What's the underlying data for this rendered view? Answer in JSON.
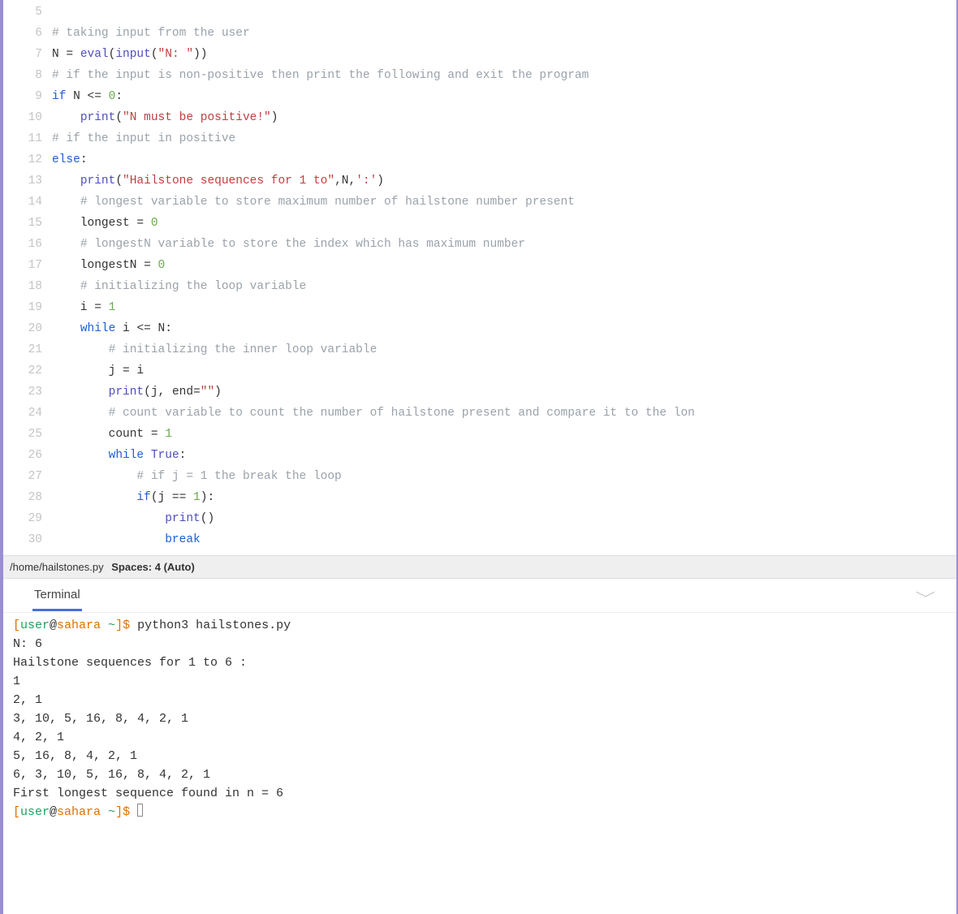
{
  "editor": {
    "lines": [
      {
        "n": "5",
        "segs": []
      },
      {
        "n": "6",
        "segs": [
          {
            "c": "cm",
            "t": "# taking input from the user"
          }
        ]
      },
      {
        "n": "7",
        "segs": [
          {
            "c": "id",
            "t": "N "
          },
          {
            "c": "op",
            "t": "= "
          },
          {
            "c": "bi",
            "t": "eval"
          },
          {
            "c": "op",
            "t": "("
          },
          {
            "c": "bi",
            "t": "input"
          },
          {
            "c": "op",
            "t": "("
          },
          {
            "c": "st",
            "t": "\"N: \""
          },
          {
            "c": "op",
            "t": "))"
          }
        ]
      },
      {
        "n": "8",
        "segs": [
          {
            "c": "cm",
            "t": "# if the input is non-positive then print the following and exit the program"
          }
        ]
      },
      {
        "n": "9",
        "segs": [
          {
            "c": "kw",
            "t": "if"
          },
          {
            "c": "id",
            "t": " N "
          },
          {
            "c": "op",
            "t": "<= "
          },
          {
            "c": "nm",
            "t": "0"
          },
          {
            "c": "op",
            "t": ":"
          }
        ]
      },
      {
        "n": "10",
        "segs": [
          {
            "c": "id",
            "t": "    "
          },
          {
            "c": "bi",
            "t": "print"
          },
          {
            "c": "op",
            "t": "("
          },
          {
            "c": "st",
            "t": "\"N must be positive!\""
          },
          {
            "c": "op",
            "t": ")"
          }
        ]
      },
      {
        "n": "11",
        "segs": [
          {
            "c": "cm",
            "t": "# if the input in positive"
          }
        ]
      },
      {
        "n": "12",
        "segs": [
          {
            "c": "kw",
            "t": "else"
          },
          {
            "c": "op",
            "t": ":"
          }
        ]
      },
      {
        "n": "13",
        "segs": [
          {
            "c": "id",
            "t": "    "
          },
          {
            "c": "bi",
            "t": "print"
          },
          {
            "c": "op",
            "t": "("
          },
          {
            "c": "st",
            "t": "\"Hailstone sequences for 1 to\""
          },
          {
            "c": "op",
            "t": ",N,"
          },
          {
            "c": "st",
            "t": "':'"
          },
          {
            "c": "op",
            "t": ")"
          }
        ]
      },
      {
        "n": "14",
        "segs": [
          {
            "c": "id",
            "t": "    "
          },
          {
            "c": "cm",
            "t": "# longest variable to store maximum number of hailstone number present"
          }
        ]
      },
      {
        "n": "15",
        "segs": [
          {
            "c": "id",
            "t": "    longest "
          },
          {
            "c": "op",
            "t": "= "
          },
          {
            "c": "nm",
            "t": "0"
          }
        ]
      },
      {
        "n": "16",
        "segs": [
          {
            "c": "id",
            "t": "    "
          },
          {
            "c": "cm",
            "t": "# longestN variable to store the index which has maximum number"
          }
        ]
      },
      {
        "n": "17",
        "segs": [
          {
            "c": "id",
            "t": "    longestN "
          },
          {
            "c": "op",
            "t": "= "
          },
          {
            "c": "nm",
            "t": "0"
          }
        ]
      },
      {
        "n": "18",
        "segs": [
          {
            "c": "id",
            "t": "    "
          },
          {
            "c": "cm",
            "t": "# initializing the loop variable"
          }
        ]
      },
      {
        "n": "19",
        "segs": [
          {
            "c": "id",
            "t": "    i "
          },
          {
            "c": "op",
            "t": "= "
          },
          {
            "c": "nm",
            "t": "1"
          }
        ]
      },
      {
        "n": "20",
        "segs": [
          {
            "c": "id",
            "t": "    "
          },
          {
            "c": "kw",
            "t": "while"
          },
          {
            "c": "id",
            "t": " i "
          },
          {
            "c": "op",
            "t": "<= "
          },
          {
            "c": "id",
            "t": "N:"
          }
        ]
      },
      {
        "n": "21",
        "segs": [
          {
            "c": "id",
            "t": "        "
          },
          {
            "c": "cm",
            "t": "# initializing the inner loop variable"
          }
        ]
      },
      {
        "n": "22",
        "segs": [
          {
            "c": "id",
            "t": "        j "
          },
          {
            "c": "op",
            "t": "= "
          },
          {
            "c": "id",
            "t": "i"
          }
        ]
      },
      {
        "n": "23",
        "segs": [
          {
            "c": "id",
            "t": "        "
          },
          {
            "c": "bi",
            "t": "print"
          },
          {
            "c": "op",
            "t": "(j, end="
          },
          {
            "c": "st",
            "t": "\"\""
          },
          {
            "c": "op",
            "t": ")"
          }
        ]
      },
      {
        "n": "24",
        "segs": [
          {
            "c": "id",
            "t": "        "
          },
          {
            "c": "cm",
            "t": "# count variable to count the number of hailstone present and compare it to the lon"
          }
        ]
      },
      {
        "n": "25",
        "segs": [
          {
            "c": "id",
            "t": "        count "
          },
          {
            "c": "op",
            "t": "= "
          },
          {
            "c": "nm",
            "t": "1"
          }
        ]
      },
      {
        "n": "26",
        "segs": [
          {
            "c": "id",
            "t": "        "
          },
          {
            "c": "kw",
            "t": "while"
          },
          {
            "c": "id",
            "t": " "
          },
          {
            "c": "bi",
            "t": "True"
          },
          {
            "c": "op",
            "t": ":"
          }
        ]
      },
      {
        "n": "27",
        "segs": [
          {
            "c": "id",
            "t": "            "
          },
          {
            "c": "cm",
            "t": "# if j = 1 the break the loop"
          }
        ]
      },
      {
        "n": "28",
        "segs": [
          {
            "c": "id",
            "t": "            "
          },
          {
            "c": "kw",
            "t": "if"
          },
          {
            "c": "op",
            "t": "(j == "
          },
          {
            "c": "nm",
            "t": "1"
          },
          {
            "c": "op",
            "t": "):"
          }
        ]
      },
      {
        "n": "29",
        "segs": [
          {
            "c": "id",
            "t": "                "
          },
          {
            "c": "bi",
            "t": "print"
          },
          {
            "c": "op",
            "t": "()"
          }
        ]
      },
      {
        "n": "30",
        "segs": [
          {
            "c": "id",
            "t": "                "
          },
          {
            "c": "kw",
            "t": "break"
          }
        ]
      }
    ]
  },
  "statusbar": {
    "path": "/home/hailstones.py",
    "spaces": "Spaces: 4 (Auto)"
  },
  "terminal": {
    "tab_label": "Terminal",
    "prompt_user": "user",
    "prompt_host": "sahara",
    "prompt_tilde": "~",
    "prompt_suffix": "]$ ",
    "command1": "python3 hailstones.py",
    "output_lines": [
      "N: 6",
      "Hailstone sequences for 1 to 6 :",
      "1",
      "2, 1",
      "3, 10, 5, 16, 8, 4, 2, 1",
      "4, 2, 1",
      "5, 16, 8, 4, 2, 1",
      "6, 3, 10, 5, 16, 8, 4, 2, 1",
      "First longest sequence found in n = 6"
    ],
    "command2": ""
  }
}
